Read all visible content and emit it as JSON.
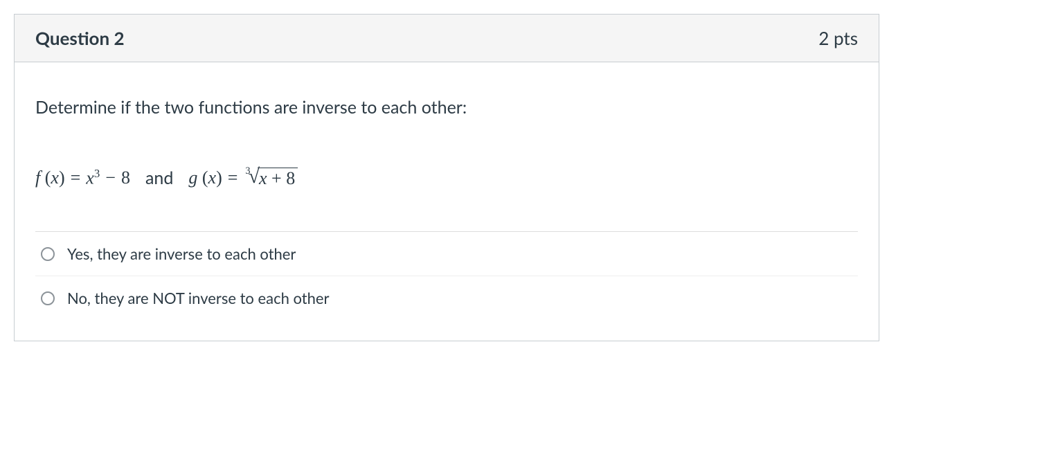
{
  "header": {
    "title": "Question 2",
    "points": "2 pts"
  },
  "body": {
    "prompt": "Determine if the two functions are inverse to each other:",
    "equation": {
      "f_lhs_fn": "f",
      "open_paren": "(",
      "var": "x",
      "close_paren": ")",
      "equals": "=",
      "f_term_base": "x",
      "f_term_exp": "3",
      "minus": "−",
      "eight": "8",
      "and": "and",
      "g_lhs_fn": "g",
      "root_index": "3",
      "radicand_var": "x",
      "plus": "+",
      "radicand_const": "8"
    }
  },
  "answers": [
    {
      "label": "Yes, they are inverse to each other"
    },
    {
      "label": "No, they are NOT inverse to each other"
    }
  ]
}
